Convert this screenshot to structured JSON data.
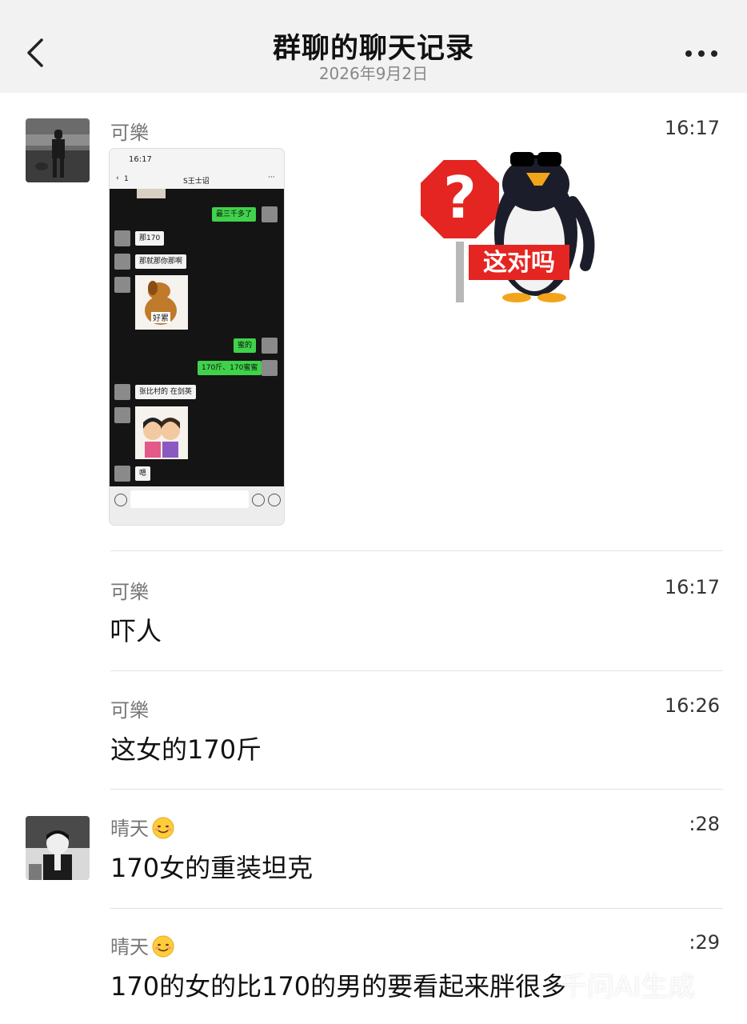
{
  "header": {
    "title": "群聊的聊天记录",
    "date": "2026年9月2日"
  },
  "embedded_screenshot": {
    "status_time": "16:17",
    "chat_title": "S王士诏",
    "back_count": "1",
    "bubbles": {
      "b1": "最三千多了",
      "b2": "那170",
      "b3": "那就那你那啊",
      "b4": "蜜的",
      "b5": "170斤、170蜜蜜",
      "b6": "张比村的 在剑英",
      "b7": "嗯"
    },
    "sticker_dog_text": "好累"
  },
  "sticker": {
    "caption": "这对吗",
    "sign_symbol": "?"
  },
  "messages": [
    {
      "sender": "可樂",
      "time": "16:17"
    },
    {
      "sender": "可樂",
      "time": "16:17",
      "text": "吓人"
    },
    {
      "sender": "可樂",
      "time": "16:26",
      "text": "这女的170斤"
    },
    {
      "sender": "晴天",
      "time": ":28",
      "text": "170女的重装坦克"
    },
    {
      "sender": "晴天",
      "time": ":29",
      "text": "170的女的比170的男的要看起来胖很多"
    }
  ],
  "icons": {
    "back": "chevron-left-icon",
    "more": "more-dots-icon",
    "emoji": "smiley-emoji-icon"
  },
  "watermark": "千问AI生成"
}
